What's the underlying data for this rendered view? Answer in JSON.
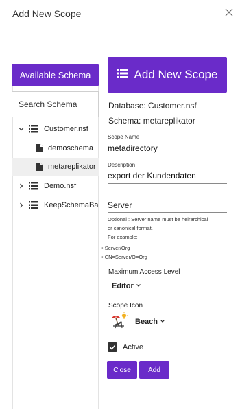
{
  "dialog": {
    "title": "Add New Scope"
  },
  "left": {
    "available_label": "Available Schema",
    "search_placeholder": "Search Schema",
    "tree": [
      {
        "label": "Customer.nsf",
        "type": "database",
        "expanded": true
      },
      {
        "label": "demoschema",
        "type": "schema"
      },
      {
        "label": "metareplikator",
        "type": "schema",
        "selected": true
      },
      {
        "label": "Demo.nsf",
        "type": "database",
        "expanded": false
      },
      {
        "label": "KeepSchemaBac",
        "type": "database",
        "expanded": false
      }
    ]
  },
  "right": {
    "add_scope_label": "Add New Scope",
    "database_line": "Database: Customer.nsf",
    "schema_line": "Schema: metareplikator",
    "scope_name": {
      "label": "Scope Name",
      "value": "metadirectory"
    },
    "description": {
      "label": "Description",
      "value": "export der Kundendaten"
    },
    "server": {
      "placeholder": "Server",
      "help_line1": "Optional : Server name must be heirarchical",
      "help_line2": "or canonical format.",
      "help_line3": "For example:",
      "example1": "Server/Org",
      "example2": "CN=Server/O=Org"
    },
    "access": {
      "label": "Maximum Access Level",
      "value": "Editor"
    },
    "icon": {
      "label": "Scope Icon",
      "value": "Beach",
      "icon_name": "beach-umbrella-icon"
    },
    "active_label": "Active",
    "active_checked": true,
    "close_label": "Close",
    "add_label": "Add"
  },
  "colors": {
    "accent": "#6a2bc9"
  }
}
